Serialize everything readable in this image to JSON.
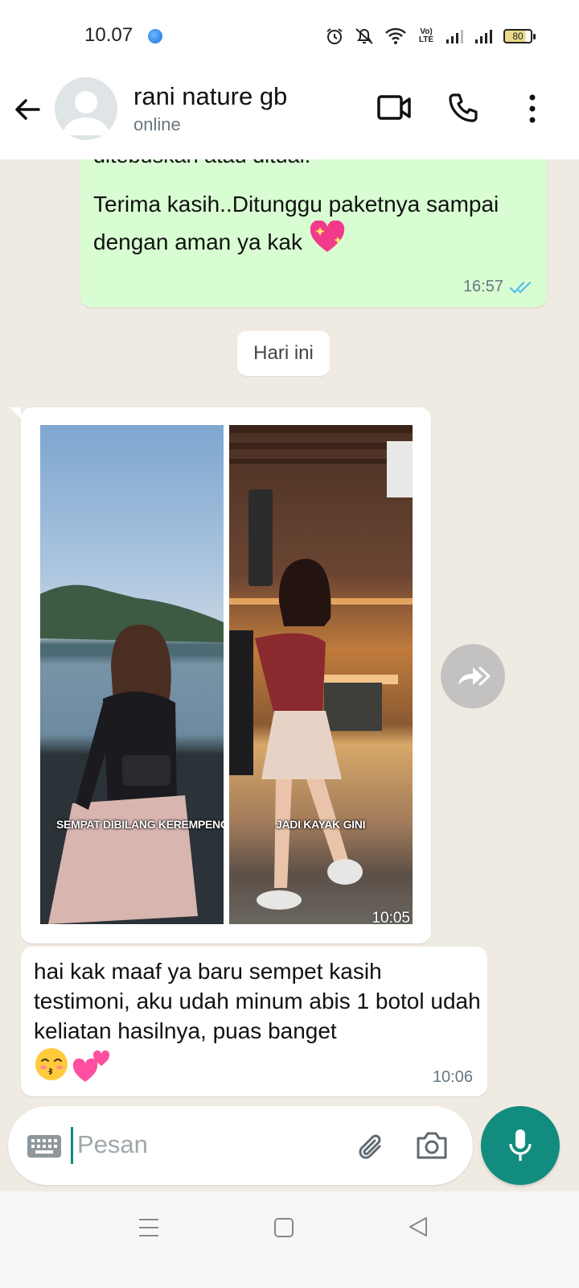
{
  "status_bar": {
    "time": "10.07",
    "volte_line1": "Vo)",
    "volte_line2": "LTE",
    "battery": "80"
  },
  "header": {
    "contact_name": "rani nature gb",
    "contact_status": "online"
  },
  "messages": {
    "outgoing_cut_text": "ditebuskan atau dituai.",
    "outgoing_text": "Terima kasih..Ditunggu paketnya sampai dengan aman ya kak",
    "outgoing_time": "16:57",
    "date_chip": "Hari ini",
    "image_caption_left": "SEMPAT DIBILANG KEREMPENG",
    "image_caption_right": "JADI KAYAK GINI",
    "image_time": "10:05",
    "incoming_text": "hai kak maaf ya baru sempet kasih testimoni, aku udah minum abis 1 botol udah keliatan hasilnya, puas banget",
    "incoming_time": "10:06"
  },
  "composer": {
    "placeholder": "Pesan"
  },
  "colors": {
    "outgoing_bubble": "#d9fdd3",
    "accent": "#128c7e",
    "read_ticks": "#53bdeb",
    "chat_bg": "#efeae2"
  },
  "icons": [
    "back-arrow-icon",
    "video-call-icon",
    "voice-call-icon",
    "more-options-icon",
    "forward-icon",
    "keyboard-icon",
    "attach-icon",
    "camera-icon",
    "mic-icon",
    "sparkling-heart-emoji",
    "kissing-face-emoji",
    "two-hearts-emoji"
  ]
}
